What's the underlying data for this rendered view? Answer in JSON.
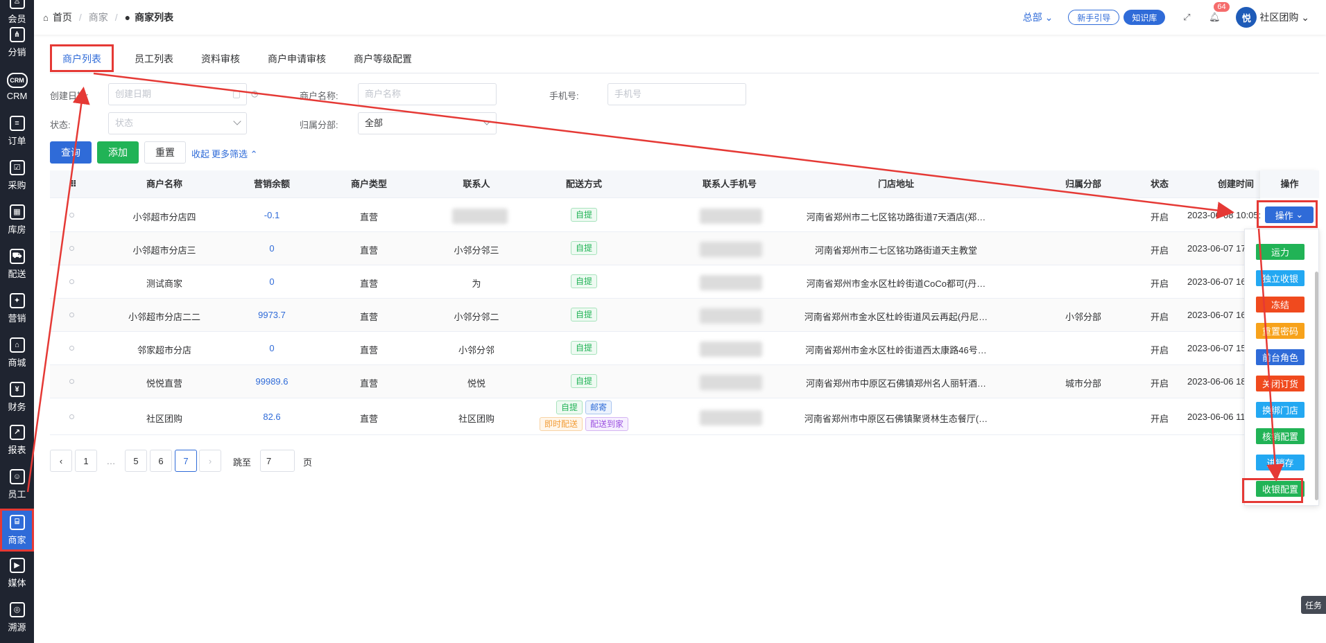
{
  "sidebar": {
    "items": [
      {
        "label": "会员",
        "icon": "member-icon",
        "glyph": "♙"
      },
      {
        "label": "分销",
        "icon": "distribution-icon",
        "glyph": "⋔"
      },
      {
        "label": "CRM",
        "icon": "crm-icon",
        "glyph": "CRM"
      },
      {
        "label": "订单",
        "icon": "order-icon",
        "glyph": "≡"
      },
      {
        "label": "采购",
        "icon": "purchase-icon",
        "glyph": "☑"
      },
      {
        "label": "库房",
        "icon": "warehouse-icon",
        "glyph": "▦"
      },
      {
        "label": "配送",
        "icon": "delivery-icon",
        "glyph": "⛟"
      },
      {
        "label": "营销",
        "icon": "gift-icon",
        "glyph": "✦"
      },
      {
        "label": "商城",
        "icon": "mall-icon",
        "glyph": "⌂"
      },
      {
        "label": "财务",
        "icon": "finance-icon",
        "glyph": "¥"
      },
      {
        "label": "报表",
        "icon": "report-icon",
        "glyph": "↗"
      },
      {
        "label": "员工",
        "icon": "staff-icon",
        "glyph": "☺"
      },
      {
        "label": "商家",
        "icon": "merchant-icon",
        "glyph": "⌸"
      },
      {
        "label": "媒体",
        "icon": "media-icon",
        "glyph": "▶"
      },
      {
        "label": "溯源",
        "icon": "trace-icon",
        "glyph": "◎"
      }
    ]
  },
  "header": {
    "breadcrumb": [
      "首页",
      "商家",
      "商家列表"
    ],
    "hq": "总部",
    "guide": "新手引导",
    "kb": "知识库",
    "notif_count": "64",
    "avatar_text": "悦",
    "user": "社区团购"
  },
  "tabs": [
    "商户列表",
    "员工列表",
    "资料审核",
    "商户申请审核",
    "商户等级配置"
  ],
  "filters": {
    "date_label": "创建日期:",
    "date_ph": "创建日期",
    "name_label": "商户名称:",
    "name_ph": "商户名称",
    "phone_label": "手机号:",
    "phone_ph": "手机号",
    "status_label": "状态:",
    "status_ph": "状态",
    "branch_label": "归属分部:",
    "branch_val": "全部",
    "query": "查询",
    "add": "添加",
    "reset": "重置",
    "collapse": "收起",
    "more": "更多筛选"
  },
  "table": {
    "headers": [
      "商户名称",
      "营销余额",
      "商户类型",
      "联系人",
      "配送方式",
      "联系人手机号",
      "门店地址",
      "归属分部",
      "状态",
      "创建时间",
      "操作"
    ],
    "rows": [
      {
        "name": "小邻超市分店四",
        "balance": "-0.1",
        "type": "直营",
        "contact": "",
        "tags": [
          "自提"
        ],
        "address": "河南省郑州市二七区铭功路街道7天酒店(郑…",
        "branch": "",
        "status": "开启",
        "time": "2023-06-08 10:05:19"
      },
      {
        "name": "小邻超市分店三",
        "balance": "0",
        "type": "直营",
        "contact": "小邻分邻三",
        "tags": [
          "自提"
        ],
        "address": "河南省郑州市二七区铭功路街道天主教堂",
        "branch": "",
        "status": "开启",
        "time": "2023-06-07 17:24"
      },
      {
        "name": "测试商家",
        "balance": "0",
        "type": "直营",
        "contact": "为",
        "tags": [
          "自提"
        ],
        "address": "河南省郑州市金水区杜岭街道CoCo都可(丹…",
        "branch": "",
        "status": "开启",
        "time": "2023-06-07 16:08"
      },
      {
        "name": "小邻超市分店二二",
        "balance": "9973.7",
        "type": "直营",
        "contact": "小邻分邻二",
        "tags": [
          "自提"
        ],
        "address": "河南省郑州市金水区杜岭街道风云再起(丹尼…",
        "branch": "小邻分部",
        "status": "开启",
        "time": "2023-06-07 16:05"
      },
      {
        "name": "邻家超市分店",
        "balance": "0",
        "type": "直营",
        "contact": "小邻分邻",
        "tags": [
          "自提"
        ],
        "address": "河南省郑州市金水区杜岭街道西太康路46号…",
        "branch": "",
        "status": "开启",
        "time": "2023-06-07 15:22"
      },
      {
        "name": "悦悦直营",
        "balance": "99989.6",
        "type": "直营",
        "contact": "悦悦",
        "tags": [
          "自提"
        ],
        "address": "河南省郑州市中原区石佛镇郑州名人丽轩酒…",
        "branch": "城市分部",
        "status": "开启",
        "time": "2023-06-06 18:02"
      },
      {
        "name": "社区团购",
        "balance": "82.6",
        "type": "直营",
        "contact": "社区团购",
        "tags": [
          "自提",
          "邮寄",
          "即时配送",
          "配送到家"
        ],
        "address": "河南省郑州市中原区石佛镇聚贤林生态餐厅(…",
        "branch": "",
        "status": "开启",
        "time": "2023-06-06 11:59"
      }
    ]
  },
  "ops": {
    "button": "操作",
    "menu": [
      {
        "label": "运力",
        "color": "#21b356"
      },
      {
        "label": "独立收银",
        "color": "#23a8f2"
      },
      {
        "label": "冻结",
        "color": "#f04a1e"
      },
      {
        "label": "重置密码",
        "color": "#f7a21b"
      },
      {
        "label": "前台角色",
        "color": "#2f6bd8"
      },
      {
        "label": "关闭订货",
        "color": "#f04a1e"
      },
      {
        "label": "换绑门店",
        "color": "#23a8f2"
      },
      {
        "label": "核销配置",
        "color": "#21b356"
      },
      {
        "label": "进销存",
        "color": "#23a8f2"
      },
      {
        "label": "收银配置",
        "color": "#21b356"
      }
    ]
  },
  "pagination": {
    "pages": [
      "1",
      "…",
      "5",
      "6",
      "7"
    ],
    "current": "7",
    "jump_label": "跳至",
    "jump_val": "7",
    "page_unit": "页"
  },
  "task": "任务"
}
